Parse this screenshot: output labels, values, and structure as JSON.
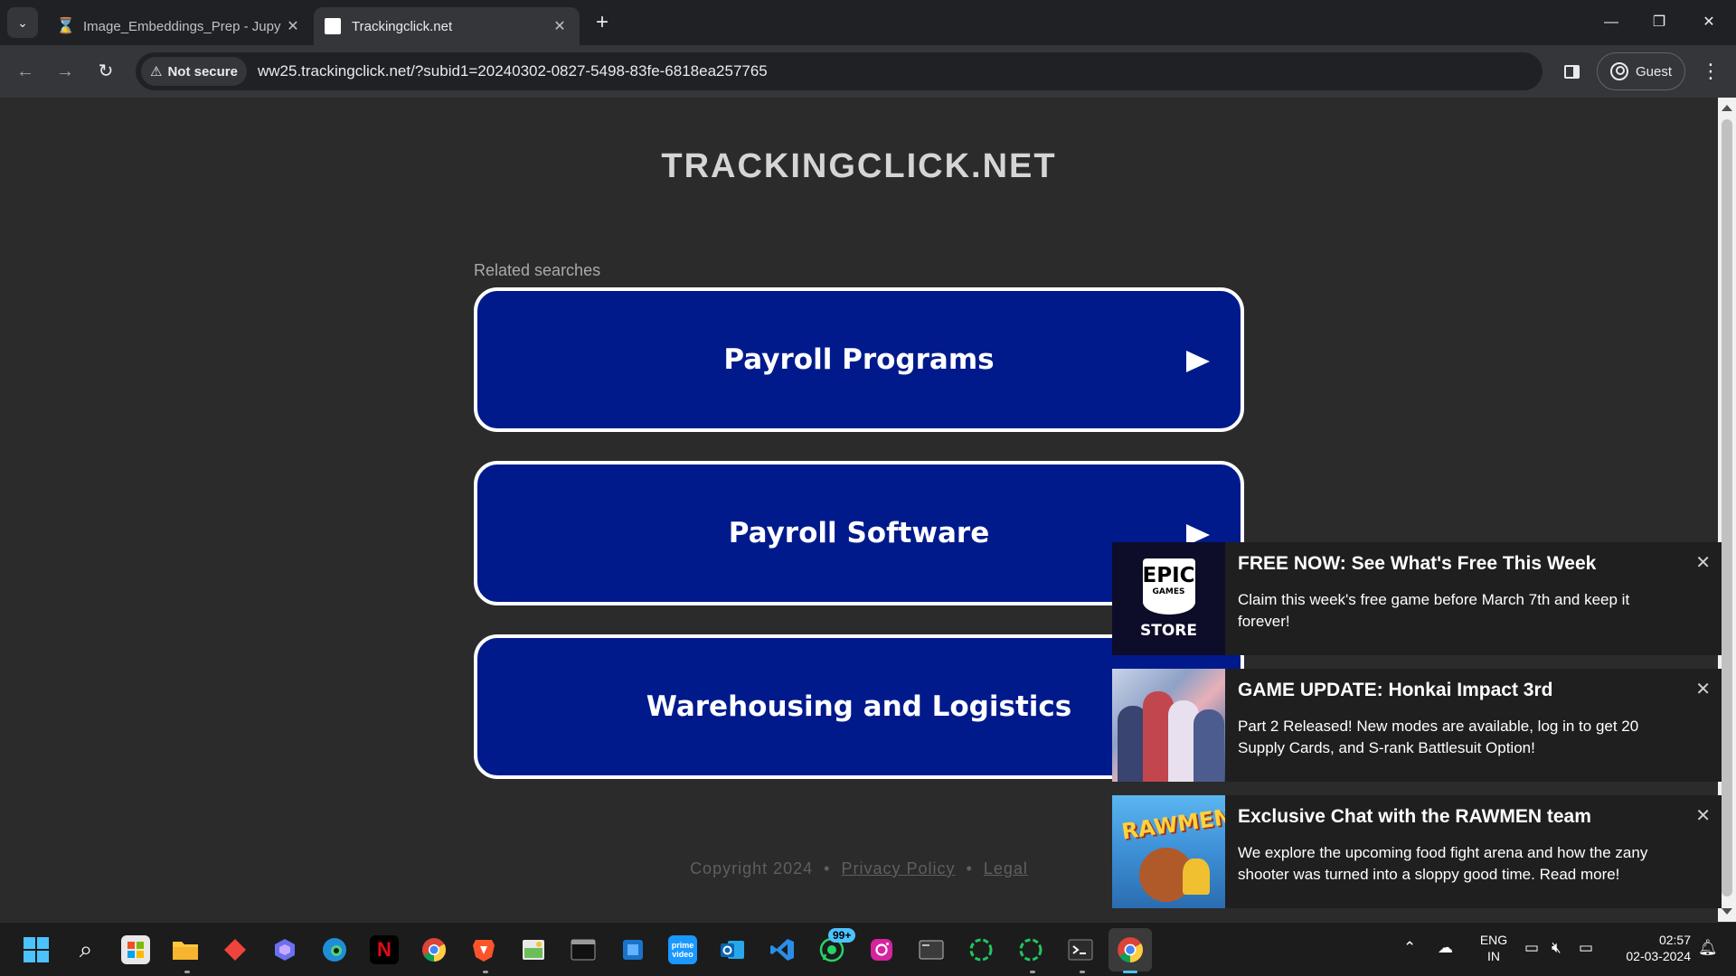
{
  "browser": {
    "tabs": [
      {
        "title": "Image_Embeddings_Prep - Jupy",
        "icon": "jupyter-hourglass-icon",
        "active": false
      },
      {
        "title": "Trackingclick.net",
        "icon": "blank-page-icon",
        "active": true
      }
    ],
    "security_label": "Not secure",
    "url": "ww25.trackingclick.net/?subid1=20240302-0827-5498-83fe-6818ea257765",
    "profile_label": "Guest"
  },
  "page": {
    "site_title": "TRACKINGCLICK.NET",
    "related_label": "Related searches",
    "searches": [
      "Payroll Programs",
      "Payroll Software",
      "Warehousing and Logistics"
    ],
    "footer": {
      "copyright": "Copyright 2024",
      "separator": "•",
      "privacy": "Privacy Policy",
      "legal": "Legal"
    },
    "colors": {
      "button_bg": "#001a8c",
      "button_border": "#ffffff",
      "page_bg": "#2b2b2b"
    }
  },
  "notifications": [
    {
      "title": "FREE NOW: See What's Free This Week",
      "text": "Claim this week's free game before March 7th and keep it forever!",
      "thumb_text": "EPIC",
      "thumb_sub": "GAMES",
      "thumb_store": "STORE"
    },
    {
      "title": "GAME UPDATE: Honkai Impact 3rd",
      "text": "Part 2 Released! New modes are available, log in to get 20 Supply Cards, and S-rank Battlesuit Option!"
    },
    {
      "title": "Exclusive Chat with the RAWMEN team",
      "text": "We explore the upcoming food fight arena and how the zany shooter was turned into a sloppy good time. Read more!",
      "thumb_logo": "RAWMEN"
    }
  ],
  "taskbar": {
    "badge": "99+",
    "lang_line1": "ENG",
    "lang_line2": "IN",
    "time": "02:57",
    "date": "02-03-2024",
    "netflix_letter": "N",
    "prime_label": "prime video"
  }
}
